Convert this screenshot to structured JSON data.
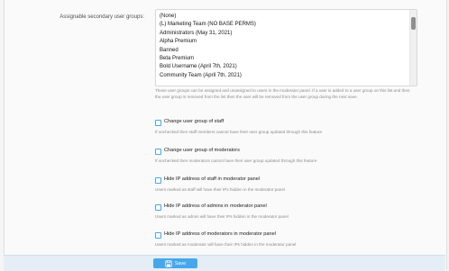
{
  "secondary_groups": {
    "label": "Assignable secondary user groups:",
    "options": [
      "(None)",
      "(L) Marketing Team (NO BASE PERMS)",
      "Administrators (May 31, 2021)",
      "Alpha Premium",
      "Banned",
      "Beta Premium",
      "Bold Username (April 7th, 2021)",
      "Community Team (April 7th, 2021)"
    ],
    "hint": "These user groups can be assigned and unassigned to users in the moderator panel. If a user is added to a user group on this list and then the user group is removed from the list then the user will be removed from the user group during the next save."
  },
  "options": [
    {
      "label": "Change user group of staff",
      "hint": "If unchecked then staff members cannot have their user group updated through this feature",
      "checked": false
    },
    {
      "label": "Change user group of moderators",
      "hint": "If unchecked then moderators cannot have their user group updated through this feature",
      "checked": false
    },
    {
      "label": "Hide IP address of staff in moderator panel",
      "hint": "Users marked as staff will have their IPs hidden in the moderator panel",
      "checked": false
    },
    {
      "label": "Hide IP address of admins in moderator panel",
      "hint": "Users marked as admin will have their IPs hidden in the moderator panel",
      "checked": false
    },
    {
      "label": "Hide IP address of moderators in moderator panel",
      "hint": "Users marked as moderator will have their IPs hidden in the moderator panel",
      "checked": false
    }
  ],
  "footer": {
    "save_label": "Save",
    "save_icon": "save-icon"
  },
  "colors": {
    "accent": "#47a7eb",
    "footer_bg": "#e5eef7"
  }
}
